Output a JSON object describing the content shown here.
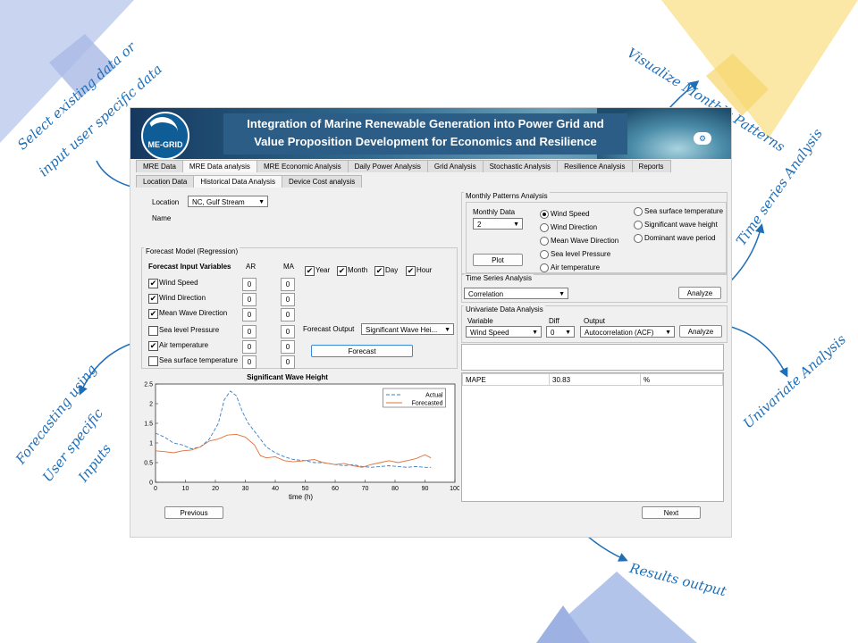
{
  "annotations": {
    "select_data": "Select existing data or input user specific data",
    "select_line1": "Select existing data or",
    "select_line2": "input user specific data",
    "visualize": "Visualize Monthly Patterns",
    "time_series": "Time series Analysis",
    "univariate": "Univariate Analysis",
    "forecasting_line1": "Forecasting using",
    "forecasting_line2": "User specific",
    "forecasting_line3": "Inputs",
    "results": "Results output"
  },
  "colors": {
    "accent": "#1f6fb8",
    "deco_blue": "#b8c8ec",
    "deco_yellow": "#f9e39b"
  },
  "banner": {
    "logo": "ME-GRID",
    "title_line1": "Integration of Marine Renewable Generation into Power Grid and",
    "title_line2": "Value Proposition Development for Economics and Resilience",
    "cloud_icon": "cloud-settings-icon"
  },
  "main_tabs": [
    "MRE Data",
    "MRE Data analysis",
    "MRE Economic Analysis",
    "Daily Power Analysis",
    "Grid Analysis",
    "Stochastic Analysis",
    "Resilience Analysis",
    "Reports"
  ],
  "sub_tabs": [
    "Location Data",
    "Historical Data Analysis",
    "Device Cost analysis"
  ],
  "location": {
    "label": "Location",
    "value": "NC, Gulf Stream",
    "name_label": "Name"
  },
  "forecast": {
    "panel_title": "Forecast Model (Regression)",
    "vars_header": "Forecast Input Variables",
    "ar_header": "AR",
    "ma_header": "MA",
    "variables": [
      {
        "label": "Wind Speed",
        "checked": "✔",
        "ar": "0",
        "ma": "0"
      },
      {
        "label": "Wind Direction",
        "checked": "✔",
        "ar": "0",
        "ma": "0"
      },
      {
        "label": "Mean Wave Direction",
        "checked": "✔",
        "ar": "0",
        "ma": "0"
      },
      {
        "label": "Sea level Pressure",
        "checked": "",
        "ar": "0",
        "ma": "0"
      },
      {
        "label": "Air temperature",
        "checked": "✔",
        "ar": "0",
        "ma": "0"
      },
      {
        "label": "Sea surface temperature",
        "checked": "",
        "ar": "0",
        "ma": "0"
      }
    ],
    "time_checks": [
      {
        "label": "Year",
        "checked": "✔"
      },
      {
        "label": "Month",
        "checked": "✔"
      },
      {
        "label": "Day",
        "checked": "✔"
      },
      {
        "label": "Hour",
        "checked": "✔"
      }
    ],
    "output_label": "Forecast Output",
    "output_value": "Significant Wave Hei...",
    "forecast_button": "Forecast"
  },
  "monthly": {
    "panel_title": "Monthly Patterns Analysis",
    "data_label": "Monthly Data",
    "data_value": "2",
    "plot_button": "Plot",
    "options_left": [
      {
        "label": "Wind Speed",
        "on": true
      },
      {
        "label": "Wind Direction",
        "on": false
      },
      {
        "label": "Mean Wave Direction",
        "on": false
      },
      {
        "label": "Sea level Pressure",
        "on": false
      },
      {
        "label": "Air temperature",
        "on": false
      }
    ],
    "options_right": [
      {
        "label": "Sea surface temperature",
        "on": false
      },
      {
        "label": "Significant wave height",
        "on": false
      },
      {
        "label": "Dominant wave period",
        "on": false
      }
    ]
  },
  "time_series": {
    "panel_title": "Time Series Analysis",
    "value": "Correlation",
    "analyze_button": "Analyze"
  },
  "univariate": {
    "panel_title": "Univariate Data Analysis",
    "variable_label": "Variable",
    "variable_value": "Wind Speed",
    "diff_label": "Diff",
    "diff_value": "0",
    "output_label": "Output",
    "output_value": "Autocorrelation (ACF)",
    "analyze_button": "Analyze"
  },
  "results": {
    "metric": "MAPE",
    "value": "30.83",
    "unit": "%"
  },
  "nav": {
    "previous": "Previous",
    "next": "Next"
  },
  "chart_data": {
    "type": "line",
    "title": "Significant Wave Height",
    "xlabel": "time (h)",
    "ylabel": "",
    "xlim": [
      0,
      100
    ],
    "ylim": [
      0,
      2.5
    ],
    "xticks": [
      0,
      10,
      20,
      30,
      40,
      50,
      60,
      70,
      80,
      90,
      100
    ],
    "yticks": [
      0,
      0.5,
      1,
      1.5,
      2,
      2.5
    ],
    "legend_position": "top-right",
    "series": [
      {
        "name": "Actual",
        "style": "dashed",
        "color": "#3b7fc4",
        "x": [
          0,
          3,
          6,
          9,
          12,
          15,
          18,
          21,
          23,
          25,
          27,
          29,
          31,
          33,
          35,
          37,
          40,
          43,
          46,
          50,
          53,
          56,
          60,
          63,
          66,
          69,
          72,
          75,
          78,
          81,
          84,
          87,
          90,
          92
        ],
        "y": [
          1.25,
          1.15,
          1.0,
          0.95,
          0.85,
          0.9,
          1.1,
          1.5,
          2.1,
          2.32,
          2.2,
          1.8,
          1.5,
          1.3,
          1.1,
          0.9,
          0.75,
          0.65,
          0.58,
          0.55,
          0.5,
          0.5,
          0.45,
          0.42,
          0.45,
          0.4,
          0.38,
          0.4,
          0.42,
          0.4,
          0.38,
          0.4,
          0.38,
          0.38
        ]
      },
      {
        "name": "Forecasted",
        "style": "solid",
        "color": "#e0703a",
        "x": [
          0,
          3,
          6,
          9,
          12,
          15,
          18,
          21,
          24,
          27,
          30,
          33,
          35,
          37,
          40,
          43,
          46,
          50,
          53,
          56,
          60,
          63,
          66,
          69,
          72,
          75,
          78,
          81,
          84,
          87,
          90,
          92
        ],
        "y": [
          0.8,
          0.78,
          0.75,
          0.8,
          0.82,
          0.9,
          1.05,
          1.1,
          1.2,
          1.22,
          1.15,
          0.95,
          0.68,
          0.62,
          0.65,
          0.55,
          0.52,
          0.55,
          0.58,
          0.5,
          0.45,
          0.48,
          0.42,
          0.38,
          0.45,
          0.5,
          0.55,
          0.5,
          0.55,
          0.6,
          0.7,
          0.62
        ]
      }
    ]
  }
}
